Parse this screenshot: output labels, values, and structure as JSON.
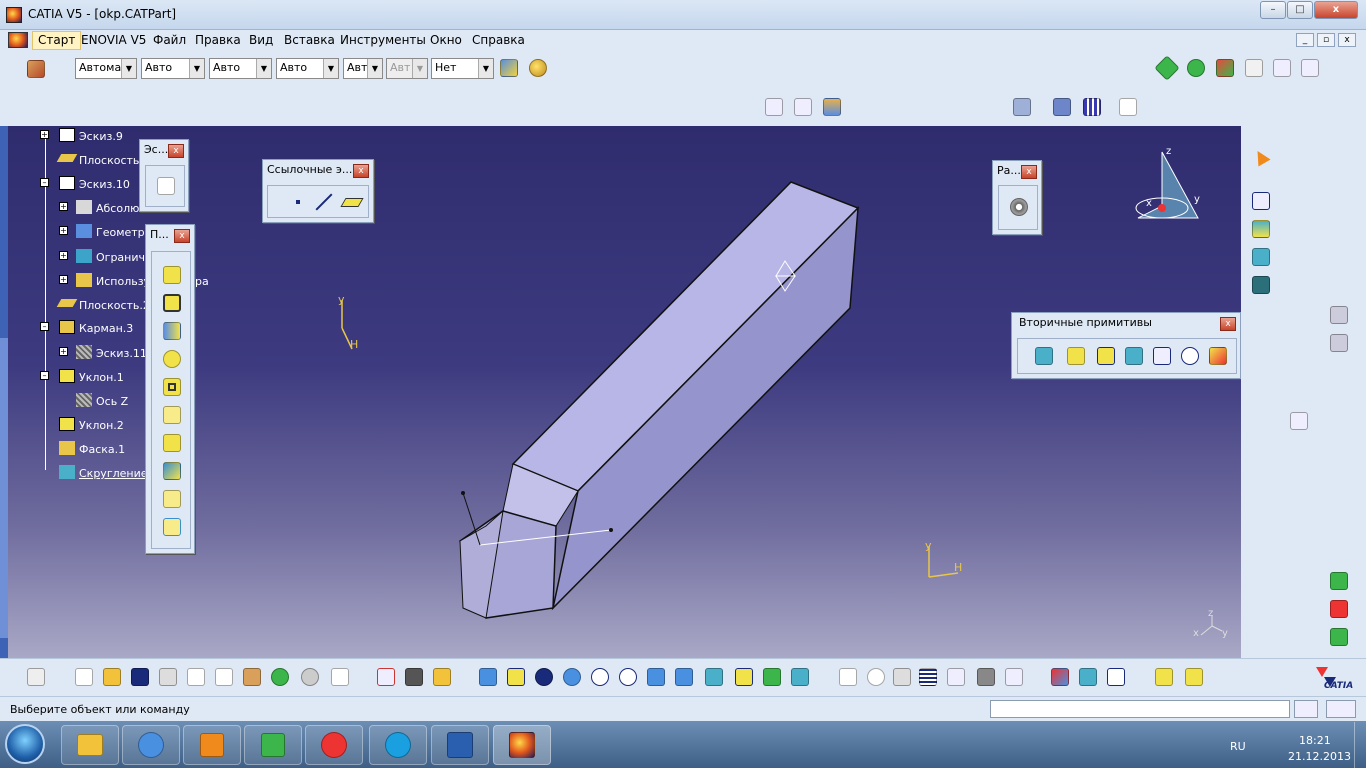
{
  "window": {
    "title": "CATIA V5 - [okp.CATPart]",
    "min": "–",
    "max": "□",
    "close": "x"
  },
  "menubar": {
    "items": [
      "Старт",
      "ENOVIA V5",
      "Файл",
      "Правка",
      "Вид",
      "Вставка",
      "Инструменты",
      "Окно",
      "Справка"
    ]
  },
  "graphic_props": {
    "selects": [
      "Автома",
      "Авто",
      "Авто",
      "Авто",
      "Авт",
      "Авт",
      "Нет"
    ]
  },
  "tree": {
    "items": [
      {
        "label": "Эскиз.9",
        "pm": "+"
      },
      {
        "label": "Плоскость.",
        "pm": ""
      },
      {
        "label": "Эскиз.10",
        "pm": "–"
      },
      {
        "label": "Абсолю",
        "pm": "+"
      },
      {
        "label": "Геометри",
        "pm": "+"
      },
      {
        "label": "Огранич",
        "pm": "+"
      },
      {
        "label": "Использу",
        "pm": "+"
      },
      {
        "label": "Плоскость.2",
        "pm": ""
      },
      {
        "label": "Карман.3",
        "pm": "–"
      },
      {
        "label": "Эскиз.11",
        "pm": "+"
      },
      {
        "label": "Уклон.1",
        "pm": "–"
      },
      {
        "label": "Ось Z",
        "pm": ""
      },
      {
        "label": "Уклон.2",
        "pm": ""
      },
      {
        "label": "Фаска.1",
        "pm": ""
      },
      {
        "label": "Скругление",
        "pm": ""
      }
    ],
    "trailing": "ра"
  },
  "palettes": {
    "sketch": {
      "title": "Эс..."
    },
    "features": {
      "title": "П..."
    },
    "reference": {
      "title": "Ссылочные э..."
    },
    "analysis": {
      "title": "Ра..."
    },
    "secondary": {
      "title": "Вторичные примитивы"
    }
  },
  "axes": {
    "y": "y",
    "h": "H",
    "z": "z",
    "x": "x"
  },
  "compass": {
    "z": "z",
    "x": "x",
    "y": "y"
  },
  "status": {
    "message": "Выберите объект или команду"
  },
  "brand": {
    "logo": "CATIA"
  },
  "taskbar": {
    "lang": "RU",
    "time": "18:21",
    "date": "21.12.2013"
  },
  "colors": {
    "viewport_top": "#2f2c6e",
    "viewport_bottom": "#a9a8c6",
    "part_top": "#b8b6e6",
    "part_side": "#8f8dc4"
  }
}
